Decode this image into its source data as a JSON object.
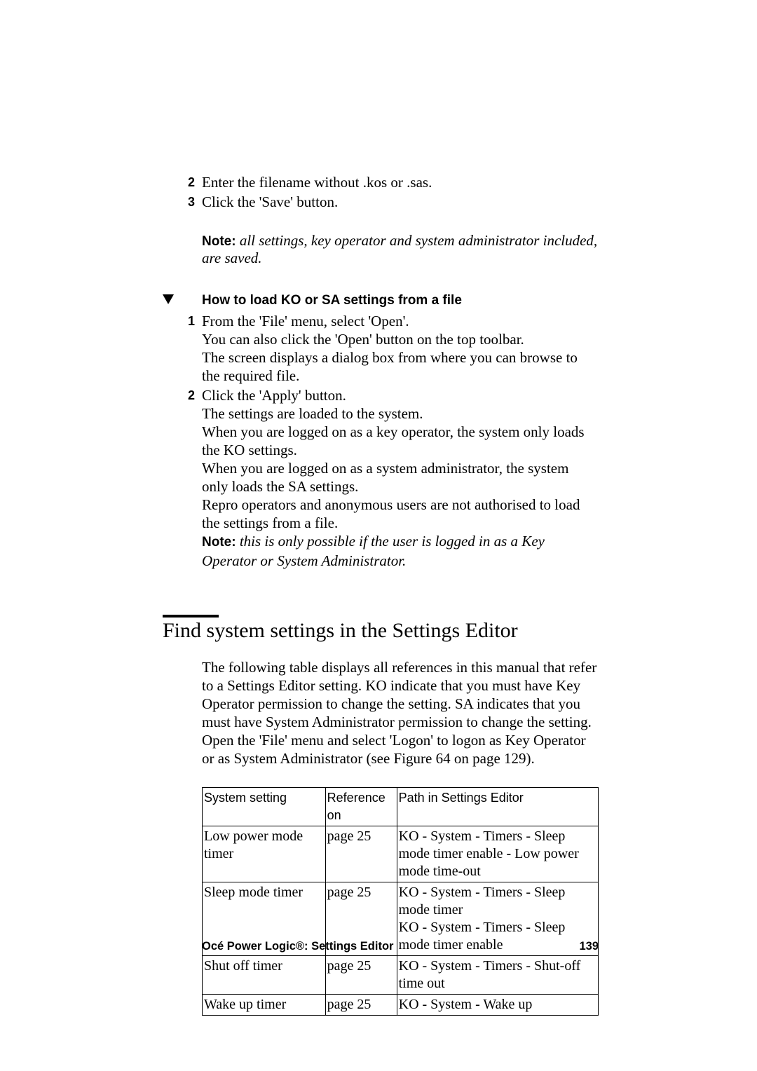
{
  "top_steps": {
    "s2": {
      "num": "2",
      "text": "Enter the filename without .kos or .sas."
    },
    "s3": {
      "num": "3",
      "text": "Click the 'Save' button."
    }
  },
  "note1": {
    "label": "Note:",
    "text": " all settings, key operator and system administrator included, are saved."
  },
  "proc": {
    "heading": "How to load KO or SA settings from a file",
    "step1": {
      "num": "1",
      "l1": "From the 'File' menu, select 'Open'.",
      "l2": "You can also click the 'Open' button on the top toolbar.",
      "l3": "The screen displays a dialog box from where you can browse to the required file."
    },
    "step2": {
      "num": "2",
      "l1": "Click the 'Apply' button.",
      "l2": "The settings are loaded to the system.",
      "l3": "When you are logged on as a key operator, the system only loads the KO settings.",
      "l4": "When you are logged on as a system administrator, the system only loads the SA settings.",
      "l5": "Repro operators and anonymous users are not authorised to load the settings from a file.",
      "note_label": "Note:",
      "note_text": " this is only possible if the user is logged in as a Key Operator or System Administrator."
    }
  },
  "section": {
    "title": "Find system settings in the Settings Editor",
    "para": "The following table displays all references in this manual that refer to a Settings Editor setting. KO indicate that you must have Key Operator permission to change the setting. SA indicates that you must have System Administrator permission to change the setting. Open the 'File' menu and select 'Logon' to logon as Key Operator or as System Administrator (see Figure 64 on page 129)."
  },
  "table": {
    "headers": {
      "c1": "System setting",
      "c2": "Reference on",
      "c3": "Path in Settings Editor"
    },
    "rows": [
      {
        "c1": "Low power mode timer",
        "c2": "page 25",
        "c3": "KO - System - Timers - Sleep mode timer enable - Low power mode time-out"
      },
      {
        "c1": "Sleep mode timer",
        "c2": "page 25",
        "c3": "KO - System - Timers - Sleep mode timer\nKO - System - Timers - Sleep mode timer enable"
      },
      {
        "c1": "Shut off timer",
        "c2": "page 25",
        "c3": "KO - System - Timers - Shut-off time out"
      },
      {
        "c1": "Wake up timer",
        "c2": "page 25",
        "c3": "KO - System - Wake up"
      }
    ]
  },
  "footer": {
    "left": "Océ Power Logic®: Settings Editor",
    "right": "139"
  }
}
